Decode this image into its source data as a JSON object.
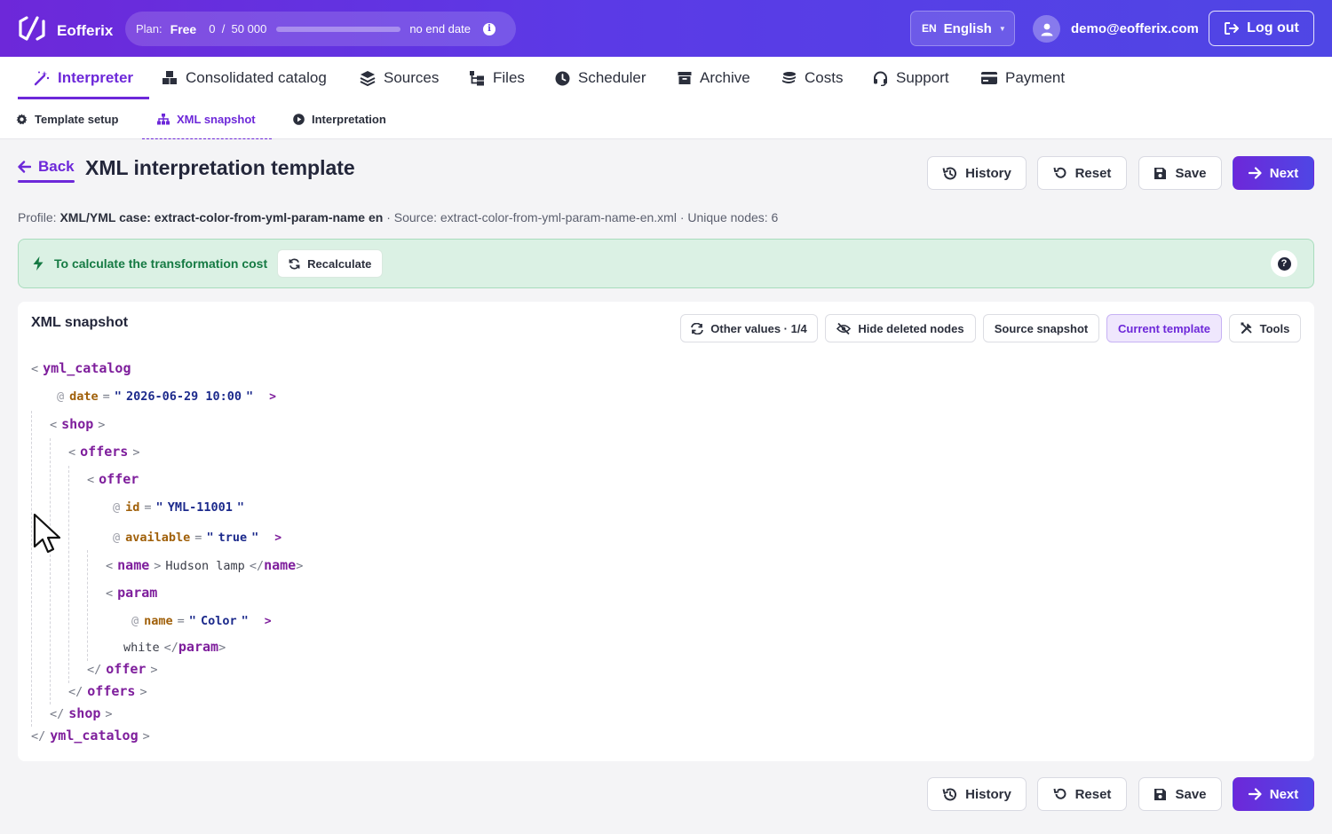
{
  "brand": {
    "name": "Eofferix"
  },
  "plan": {
    "label": "Plan:",
    "name": "Free",
    "used": "0",
    "separator": "/",
    "limit": "50 000",
    "progress": 0,
    "expiry": "no end date",
    "info_glyph": "i"
  },
  "language": {
    "code": "EN",
    "name": "English"
  },
  "user": {
    "email": "demo@eofferix.com"
  },
  "logout_label": "Log out",
  "main_nav": [
    {
      "label": "Interpreter",
      "icon": "wand-icon",
      "active": true
    },
    {
      "label": "Consolidated catalog",
      "icon": "boxes-icon"
    },
    {
      "label": "Sources",
      "icon": "layers-icon"
    },
    {
      "label": "Files",
      "icon": "folder-tree-icon"
    },
    {
      "label": "Scheduler",
      "icon": "clock-icon"
    },
    {
      "label": "Archive",
      "icon": "archive-icon"
    },
    {
      "label": "Costs",
      "icon": "coins-icon"
    },
    {
      "label": "Support",
      "icon": "headset-icon"
    },
    {
      "label": "Payment",
      "icon": "card-icon"
    }
  ],
  "sub_nav": [
    {
      "label": "Template setup",
      "icon": "gear-icon"
    },
    {
      "label": "XML snapshot",
      "icon": "sitemap-icon",
      "active": true
    },
    {
      "label": "Interpretation",
      "icon": "play-circle-icon"
    }
  ],
  "header": {
    "back_label": "Back",
    "title": "XML interpretation template",
    "actions": {
      "history": "History",
      "reset": "Reset",
      "save": "Save",
      "next": "Next"
    }
  },
  "profile": {
    "profile_label": "Profile:",
    "profile_name": "XML/YML case: extract-color-from-yml-param-name en",
    "source_text": "· Source: extract-color-from-yml-param-name-en.xml · Unique nodes: 6"
  },
  "cost_banner": {
    "text": "To calculate the transformation cost",
    "recalculate": "Recalculate",
    "help_glyph": "?"
  },
  "snapshot": {
    "title": "XML snapshot",
    "toolbar": {
      "other_values": "Other values · 1/4",
      "hide_deleted": "Hide deleted nodes",
      "source_snapshot": "Source snapshot",
      "current_template": "Current template",
      "tools": "Tools"
    },
    "tree": {
      "root": "yml_catalog",
      "root_attr_name": "date",
      "root_attr_value": "2026-06-29 10:00",
      "shop": "shop",
      "offers": "offers",
      "offer": "offer",
      "offer_attr1_name": "id",
      "offer_attr1_value": "YML-11001",
      "offer_attr2_name": "available",
      "offer_attr2_value": "true",
      "name_tag": "name",
      "name_text": "Hudson lamp",
      "param_tag": "param",
      "param_attr_name": "name",
      "param_attr_value": "Color",
      "param_text": "white"
    }
  },
  "colors": {
    "accent": "#6d28d9",
    "accent2": "#4f46e5",
    "success_bg": "#dbf1e4",
    "success_text": "#157a43"
  }
}
